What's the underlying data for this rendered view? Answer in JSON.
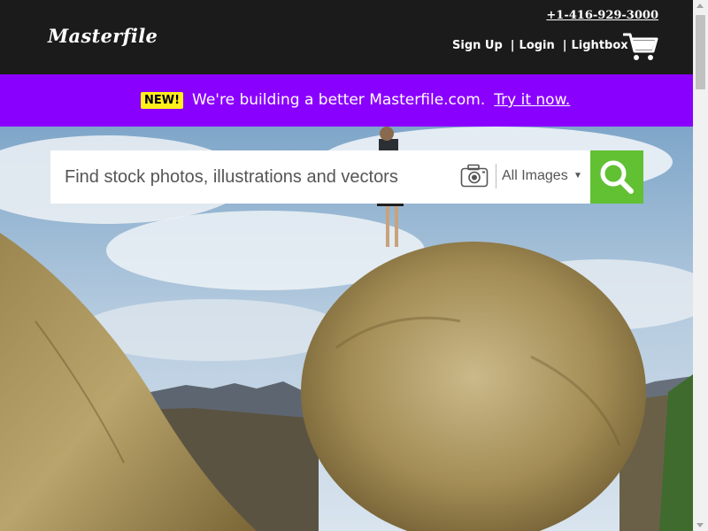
{
  "header": {
    "logo": "Masterfile",
    "phone": "+1-416-929-3000",
    "nav": {
      "sign_up": "Sign Up",
      "separator": "|",
      "login": "Login",
      "lightbox": "Lightbox"
    },
    "cart_icon": "shopping-cart-icon"
  },
  "banner": {
    "badge": "NEW!",
    "text": "We're building a better Masterfile.com.",
    "link": "Try it now."
  },
  "search": {
    "placeholder": "Find stock photos, illustrations and vectors",
    "value": "",
    "camera_icon": "camera-icon",
    "filter_label": "All Images",
    "filter_caret": "▼",
    "button_icon": "magnifier-icon"
  },
  "colors": {
    "header_bg": "#1b1b1b",
    "banner_bg": "#8a00ff",
    "badge_bg": "#ffef1a",
    "search_button": "#62c033"
  }
}
